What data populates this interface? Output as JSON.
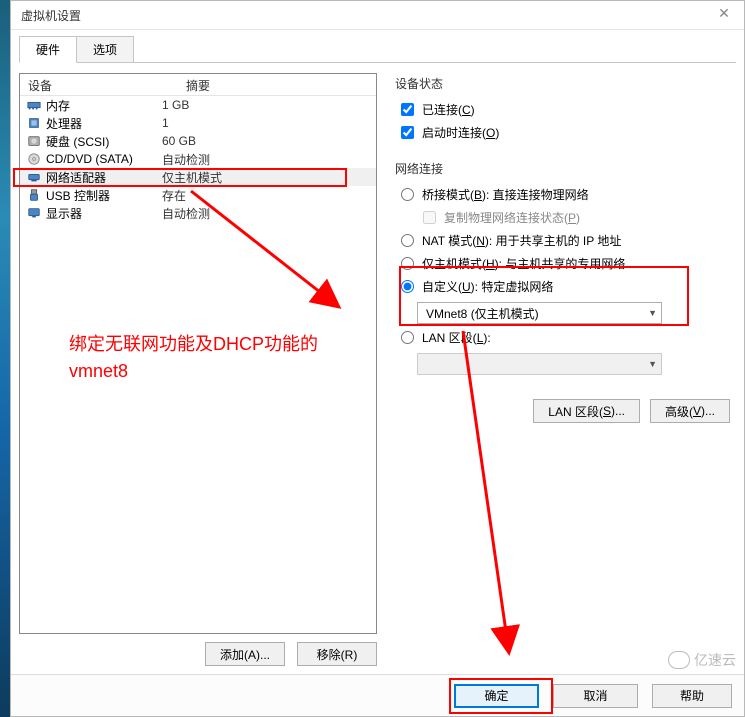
{
  "window": {
    "title": "虚拟机设置"
  },
  "tabs": {
    "hardware": "硬件",
    "options": "选项"
  },
  "list": {
    "col_device": "设备",
    "col_summary": "摘要",
    "rows": [
      {
        "name": "内存",
        "summary": "1 GB",
        "icon": "memory-icon"
      },
      {
        "name": "处理器",
        "summary": "1",
        "icon": "cpu-icon"
      },
      {
        "name": "硬盘 (SCSI)",
        "summary": "60 GB",
        "icon": "disk-icon"
      },
      {
        "name": "CD/DVD (SATA)",
        "summary": "自动检测",
        "icon": "cd-icon"
      },
      {
        "name": "网络适配器",
        "summary": "仅主机模式",
        "icon": "network-icon",
        "selected": true
      },
      {
        "name": "USB 控制器",
        "summary": "存在",
        "icon": "usb-icon"
      },
      {
        "name": "显示器",
        "summary": "自动检测",
        "icon": "display-icon"
      }
    ]
  },
  "left_buttons": {
    "add": "添加(A)...",
    "remove": "移除(R)"
  },
  "status_group": {
    "title": "设备状态",
    "connected": "已连接(C)",
    "connect_at_poweron": "启动时连接(O)"
  },
  "net_group": {
    "title": "网络连接",
    "bridge": "桥接模式(B): 直接连接物理网络",
    "bridge_replicate": "复制物理网络连接状态(P)",
    "nat": "NAT 模式(N): 用于共享主机的 IP 地址",
    "hostonly": "仅主机模式(H): 与主机共享的专用网络",
    "custom": "自定义(U): 特定虚拟网络",
    "custom_value": "VMnet8 (仅主机模式)",
    "lanseg": "LAN 区段(L):"
  },
  "right_buttons": {
    "lan": "LAN 区段(S)...",
    "adv": "高级(V)..."
  },
  "footer": {
    "ok": "确定",
    "cancel": "取消",
    "help_truncated": "帮助"
  },
  "annotations": {
    "text1": "绑定无联网功能及DHCP功能的",
    "text2": "vmnet8"
  },
  "accel": {
    "C": "C",
    "O": "O",
    "B": "B",
    "P": "P",
    "N": "N",
    "H": "H",
    "U": "U",
    "L": "L",
    "S": "S",
    "V": "V",
    "A": "A",
    "R": "R"
  },
  "watermark": "亿速云"
}
